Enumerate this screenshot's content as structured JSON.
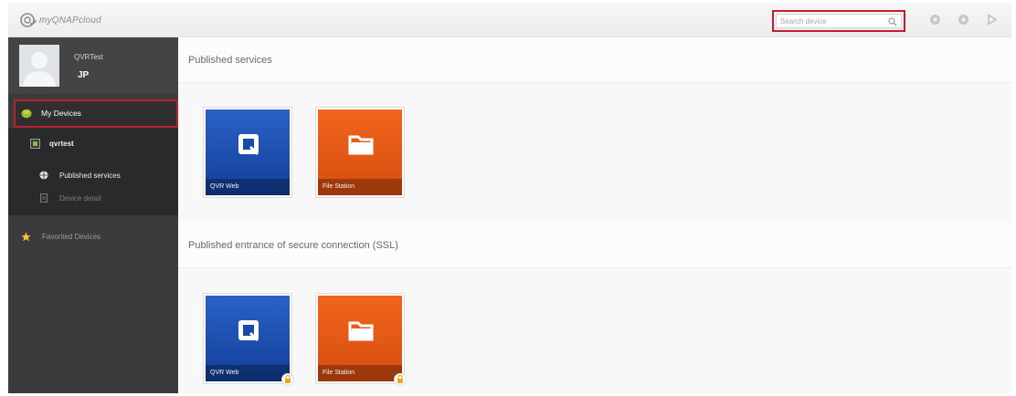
{
  "app": {
    "logo_text": "myQNAPcloud",
    "search": {
      "placeholder": "Search device"
    },
    "toolbar_icons": [
      "help-icon",
      "settings-icon",
      "logout-icon"
    ]
  },
  "sidebar": {
    "user": {
      "name": "QVRTest",
      "badge": "JP"
    },
    "nav": {
      "my_devices": "My Devices",
      "device": "qvrtest",
      "sub_items": [
        {
          "label": "Published services",
          "icon": "globe-icon",
          "active": true
        },
        {
          "label": "Device detail",
          "icon": "document-icon",
          "active": false
        }
      ],
      "favorites": "Favorited Devices"
    }
  },
  "main": {
    "published_services": {
      "title": "Published services",
      "tiles": [
        {
          "label": "QVR Web",
          "icon": "qvr-logo-icon",
          "color": "#1f50b0"
        },
        {
          "label": "File Station",
          "icon": "folder-icon",
          "color": "#e85a16"
        }
      ]
    },
    "secure_services": {
      "title": "Published entrance of secure connection (SSL)",
      "tiles": [
        {
          "label": "QVR Web",
          "icon": "qvr-logo-icon",
          "color": "#1f50b0",
          "locked": true
        },
        {
          "label": "File Station",
          "icon": "folder-icon",
          "color": "#e85a16",
          "locked": true
        }
      ]
    }
  },
  "colors": {
    "highlight": "#c21f2c",
    "sidebar_bg": "#3b3b3d",
    "submenu_bg": "#2a2a2c"
  }
}
